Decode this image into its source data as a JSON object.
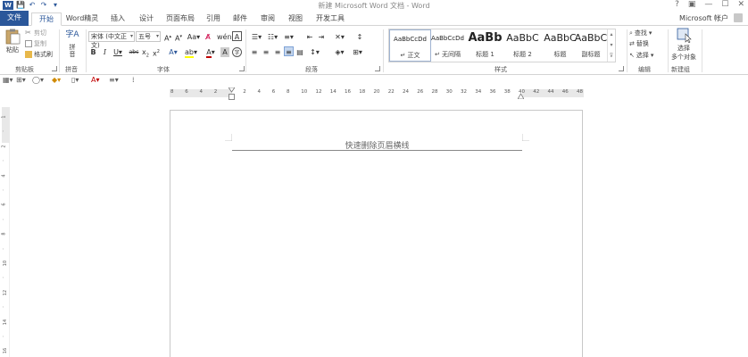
{
  "titlebar": {
    "title": "新建 Microsoft Word 文档 - Word",
    "controls": [
      "?",
      "▣",
      "—",
      "☐",
      "✕"
    ]
  },
  "tabs": [
    {
      "label": "文件"
    },
    {
      "label": "开始"
    },
    {
      "label": "Word精灵"
    },
    {
      "label": "插入"
    },
    {
      "label": "设计"
    },
    {
      "label": "页面布局"
    },
    {
      "label": "引用"
    },
    {
      "label": "邮件"
    },
    {
      "label": "审阅"
    },
    {
      "label": "视图"
    },
    {
      "label": "开发工具"
    }
  ],
  "account": "Microsoft 帐户",
  "clipboard": {
    "paste": "粘贴",
    "cut": "剪切",
    "copy": "复制",
    "format_painter": "格式刷",
    "label": "剪贴板"
  },
  "pinyin": {
    "button": "拼音",
    "label": "拼音"
  },
  "font": {
    "name": "宋体 (中文正文)",
    "size": "五号",
    "label": "字体"
  },
  "paragraph": {
    "label": "段落"
  },
  "styles": {
    "items": [
      {
        "sample": "AaBbCcDd",
        "name": "正文"
      },
      {
        "sample": "AaBbCcDd",
        "name": "无间隔"
      },
      {
        "sample": "AaBb",
        "name": "标题 1"
      },
      {
        "sample": "AaBbC",
        "name": "标题 2"
      },
      {
        "sample": "AaBbC",
        "name": "标题"
      },
      {
        "sample": "AaBbC",
        "name": "副标题"
      }
    ],
    "label": "样式"
  },
  "editing": {
    "find": "查找",
    "replace": "替换",
    "select": "选择",
    "label": "编辑"
  },
  "newgroup": {
    "button_line1": "选择",
    "button_line2": "多个对象",
    "label": "新建组"
  },
  "ruler": {
    "ticks": [
      "8",
      "6",
      "4",
      "2",
      "",
      "2",
      "4",
      "6",
      "8",
      "10",
      "12",
      "14",
      "16",
      "18",
      "20",
      "22",
      "24",
      "26",
      "28",
      "30",
      "32",
      "34",
      "36",
      "38",
      "40",
      "42",
      "44",
      "46",
      "48"
    ]
  },
  "vruler": {
    "ticks": [
      "1",
      "",
      "2",
      "",
      "4",
      "",
      "6",
      "",
      "8",
      "",
      "10",
      "",
      "12",
      "",
      "14",
      "",
      "16"
    ]
  },
  "document": {
    "header_text": "快速删除页眉横线"
  },
  "colors": {
    "accent": "#2b579a",
    "font_color": "#c00000",
    "highlight": "#ffff00"
  }
}
